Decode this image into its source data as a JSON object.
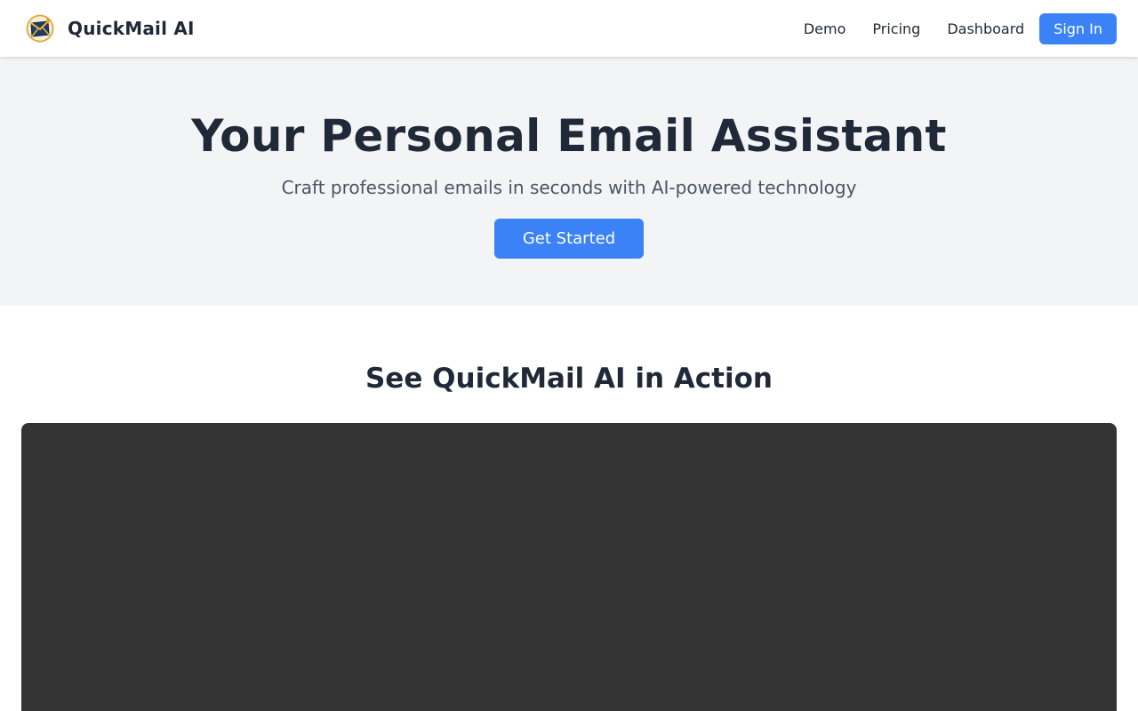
{
  "header": {
    "brand_name": "QuickMail AI",
    "logo_icon": "envelope-logo-icon",
    "nav": [
      {
        "label": "Demo"
      },
      {
        "label": "Pricing"
      },
      {
        "label": "Dashboard"
      }
    ],
    "signin_label": "Sign In"
  },
  "hero": {
    "title": "Your Personal Email Assistant",
    "subtitle": "Craft professional emails in seconds with AI-powered technology",
    "cta_label": "Get Started"
  },
  "demo": {
    "title": "See QuickMail AI in Action"
  },
  "colors": {
    "accent": "#3b82f6",
    "text_dark": "#1f2937",
    "text_muted": "#4b5563",
    "hero_bg": "#f3f4f6",
    "video_bg": "#333333"
  }
}
